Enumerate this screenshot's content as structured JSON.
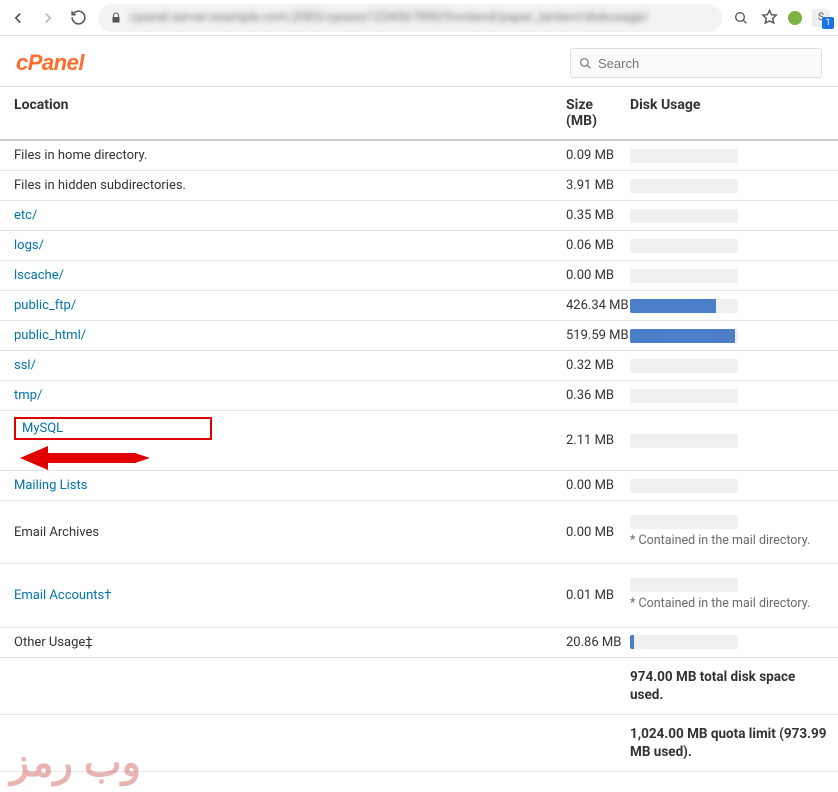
{
  "browser": {
    "url": "cpanel.server.example.com:2083/cpsess1234567890/frontend/paper_lantern/diskusage/",
    "ext_badge": "1",
    "ext_letter": "S"
  },
  "brand": "cPanel",
  "search": {
    "placeholder": "Search"
  },
  "columns": {
    "location": "Location",
    "size": "Size (MB)",
    "usage": "Disk Usage"
  },
  "rows": [
    {
      "label": "Files in home directory.",
      "link": false,
      "size": "0.09 MB",
      "pct": 0
    },
    {
      "label": "Files in hidden subdirectories.",
      "link": false,
      "size": "3.91 MB",
      "pct": 0
    },
    {
      "label": "etc/",
      "link": true,
      "size": "0.35 MB",
      "pct": 0
    },
    {
      "label": "logs/",
      "link": true,
      "size": "0.06 MB",
      "pct": 0
    },
    {
      "label": "lscache/",
      "link": true,
      "size": "0.00 MB",
      "pct": 0
    },
    {
      "label": "public_ftp/",
      "link": true,
      "size": "426.34 MB",
      "pct": 80
    },
    {
      "label": "public_html/",
      "link": true,
      "size": "519.59 MB",
      "pct": 97
    },
    {
      "label": "ssl/",
      "link": true,
      "size": "0.32 MB",
      "pct": 0
    },
    {
      "label": "tmp/",
      "link": true,
      "size": "0.36 MB",
      "pct": 0
    },
    {
      "label": "MySQL",
      "link": true,
      "size": "2.11 MB",
      "pct": 0,
      "highlight": true
    },
    {
      "label": "Mailing Lists",
      "link": true,
      "size": "0.00 MB",
      "pct": 0
    },
    {
      "label": "Email Archives",
      "link": false,
      "size": "0.00 MB",
      "pct": 0,
      "note": "* Contained in the mail directory."
    },
    {
      "label": "Email Accounts†",
      "link": true,
      "size": "0.01 MB",
      "pct": 0,
      "note": "* Contained in the mail directory."
    },
    {
      "label": "Other Usage‡",
      "link": false,
      "size": "20.86 MB",
      "pct": 4
    }
  ],
  "footer": {
    "total": "974.00 MB total disk space used.",
    "quota": "1,024.00 MB quota limit (973.99 MB used)."
  },
  "watermark": "وب رمز"
}
